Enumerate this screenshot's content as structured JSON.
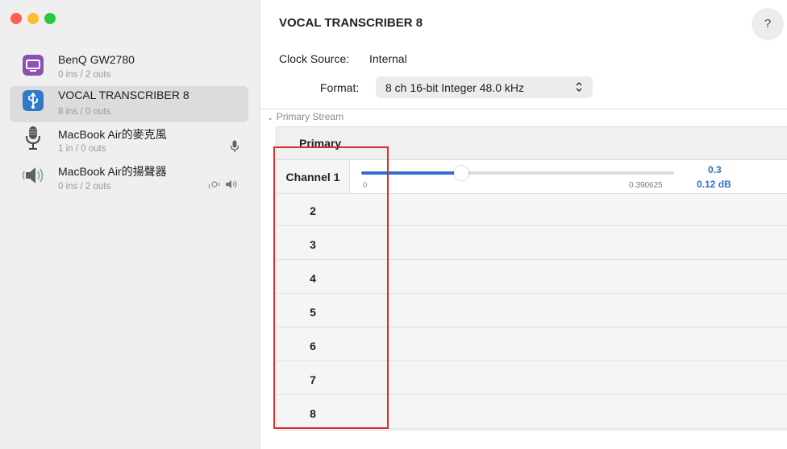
{
  "window": {
    "title": "VOCAL TRANSCRIBER 8",
    "help_label": "?"
  },
  "sidebar": {
    "devices": [
      {
        "name": "BenQ GW2780",
        "io": "0 ins / 2 outs",
        "icon": "monitor-icon",
        "selected": false
      },
      {
        "name": "VOCAL TRANSCRIBER 8",
        "io": "8 ins / 0 outs",
        "icon": "usb-icon",
        "selected": true
      },
      {
        "name": "MacBook Air的麥克風",
        "io": "1 in / 0 outs",
        "icon": "microphone-icon",
        "selected": false,
        "badge": "mic-badge-icon"
      },
      {
        "name": "MacBook Air的揚聲器",
        "io": "0 ins / 2 outs",
        "icon": "speaker-icon",
        "selected": false,
        "badge": "speaker-badges-icon"
      }
    ]
  },
  "clock": {
    "label": "Clock Source:",
    "value": "Internal"
  },
  "format": {
    "label": "Format:",
    "value": "8 ch 16-bit Integer 48.0 kHz"
  },
  "stream": {
    "header": "Primary Stream",
    "primary_label": "Primary",
    "channel1": {
      "label": "Channel 1",
      "slider_min": "0",
      "slider_max": "0.390625",
      "value": "0.3",
      "db": "0.12 dB",
      "fraction": 0.32
    },
    "channels": [
      "2",
      "3",
      "4",
      "5",
      "6",
      "7",
      "8"
    ]
  },
  "colors": {
    "accent": "#2e6fd0",
    "highlight": "#d62d2d"
  }
}
